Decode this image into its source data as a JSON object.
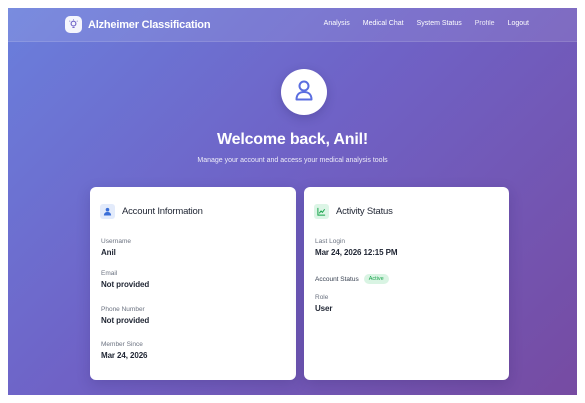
{
  "app": {
    "title": "Alzheimer Classification"
  },
  "nav": {
    "items": [
      {
        "label": "Analysis"
      },
      {
        "label": "Medical Chat"
      },
      {
        "label": "System Status"
      },
      {
        "label": "Profile"
      },
      {
        "label": "Logout"
      }
    ]
  },
  "hero": {
    "welcome": "Welcome back, Anil!",
    "subtitle": "Manage your account and access your medical analysis tools"
  },
  "account": {
    "title": "Account Information",
    "fields": [
      {
        "label": "Username",
        "value": "Anil"
      },
      {
        "label": "Email",
        "value": "Not provided"
      },
      {
        "label": "Phone Number",
        "value": "Not provided"
      },
      {
        "label": "Member Since",
        "value": "Mar 24, 2026"
      }
    ]
  },
  "activity": {
    "title": "Activity Status",
    "last_login_label": "Last Login",
    "last_login_value": "Mar 24, 2026 12:15 PM",
    "status_label": "Account Status",
    "status_badge": "Active",
    "role_label": "Role",
    "role_value": "User"
  },
  "colors": {
    "gradient_start": "#6a7fdc",
    "gradient_end": "#764ba2",
    "accent_blue": "#3b6fd8",
    "accent_green": "#16a34a"
  },
  "icons": {
    "brand": "lightbulb-icon",
    "avatar": "user-icon",
    "account": "person-icon",
    "activity": "chart-icon"
  }
}
